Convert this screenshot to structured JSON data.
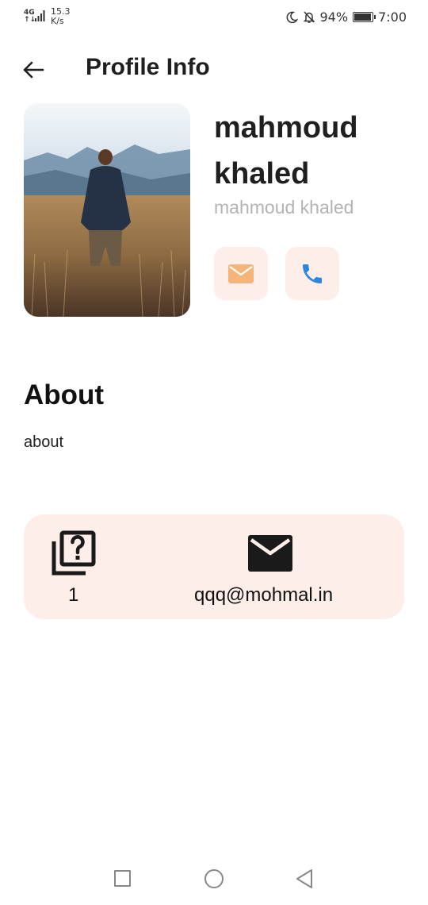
{
  "status_bar": {
    "network": "4G",
    "network_sub": "↑↓",
    "speed_value": "15.3",
    "speed_unit": "K/s",
    "battery": "94%",
    "battery_level": 0.94,
    "time": "7:00"
  },
  "header": {
    "title": "Profile Info"
  },
  "profile": {
    "name_line1": "mahmoud",
    "name_line2": "khaled",
    "username": "mahmoud khaled",
    "accent_color": "#fdeeea",
    "mail_icon_color": "#f5b57a",
    "phone_icon_color": "#2b86e0"
  },
  "about": {
    "heading": "About",
    "text": "about"
  },
  "info_card": {
    "questions_count": "1",
    "email": "qqq@mohmal.in"
  }
}
